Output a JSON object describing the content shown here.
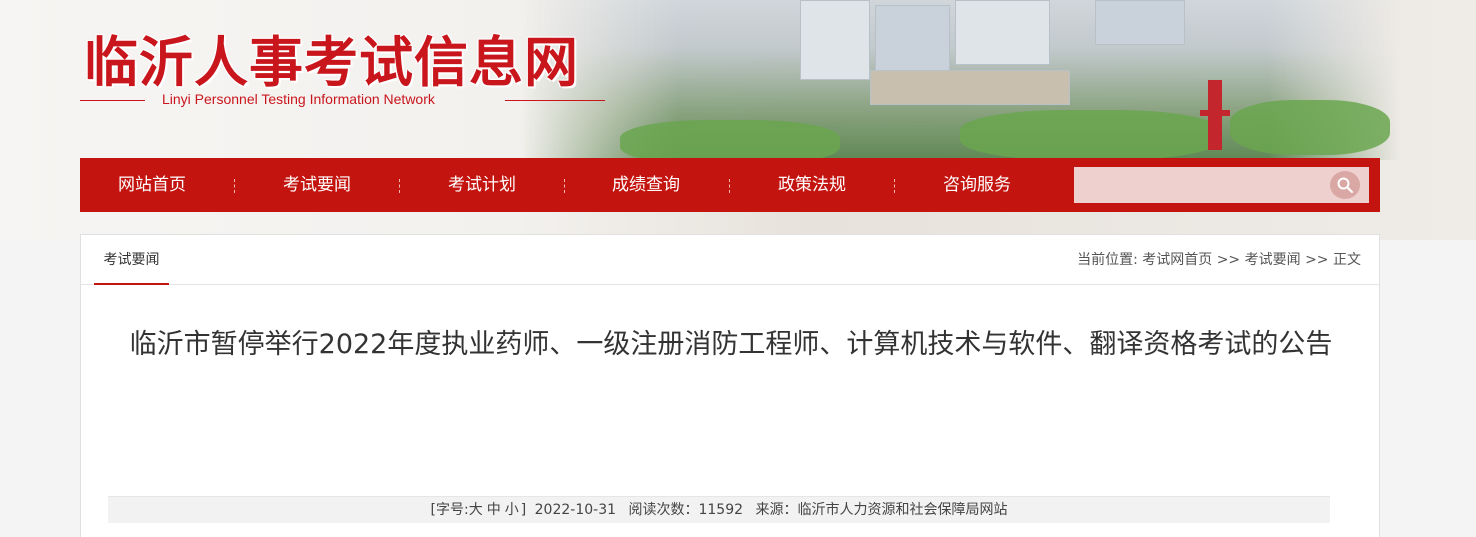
{
  "header": {
    "title": "临沂人事考试信息网",
    "subtitle": "Linyi Personnel Testing Information Network"
  },
  "nav": {
    "items": [
      "网站首页",
      "考试要闻",
      "考试计划",
      "成绩查询",
      "政策法规",
      "咨询服务"
    ],
    "search_placeholder": "",
    "search_icon": "search-icon"
  },
  "panel": {
    "tab_label": "考试要闻",
    "breadcrumb": {
      "prefix": "当前位置:",
      "items": [
        "考试网首页",
        "考试要闻",
        "正文"
      ],
      "separator": ">>"
    }
  },
  "article": {
    "title": "临沂市暂停举行2022年度执业药师、一级注册消防工程师、计算机技术与软件、翻译资格考试的公告",
    "meta": {
      "font_label_open": "[字号:",
      "font_large": "大",
      "font_medium": "中",
      "font_small": "小",
      "font_label_close": "]",
      "date": "2022-10-31",
      "read_label": "阅读次数：",
      "read_count": "11592",
      "source_label": "来源：",
      "source": "临沂市人力资源和社会保障局网站"
    }
  },
  "colors": {
    "brand_red": "#c3140f",
    "title_red": "#c9161d"
  }
}
